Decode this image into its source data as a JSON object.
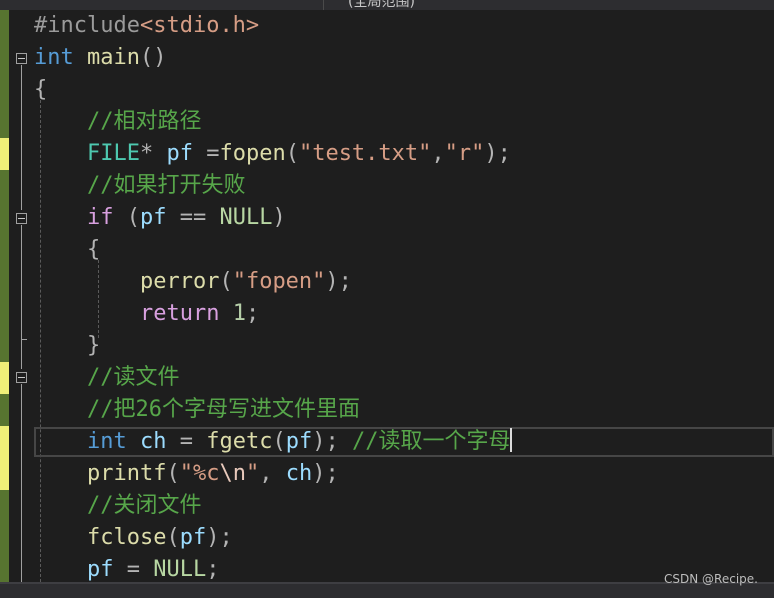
{
  "window": {
    "tab_fragment": "(全局范围)"
  },
  "editor": {
    "lines": {
      "l1_pp": "#include",
      "l1_inc": "<stdio.h>",
      "l2_kw": "int",
      "l2_fn": "main",
      "l2_pu": "()",
      "l3_pu": "{",
      "l4_cm": "//相对路径",
      "l5_ty": "FILE",
      "l5_a": "* ",
      "l5_id": "pf",
      "l5_b": " =",
      "l5_fn": "fopen",
      "l5_c": "(",
      "l5_s1": "\"test.txt\"",
      "l5_d": ",",
      "l5_s2": "\"r\"",
      "l5_e": ");",
      "l6_cm": "//如果打开失败",
      "l7_kw": "if",
      "l7_a": " (",
      "l7_id": "pf",
      "l7_b": " == ",
      "l7_mc": "NULL",
      "l7_c": ")",
      "l8_pu": "{",
      "l9_fn": "perror",
      "l9_a": "(",
      "l9_s": "\"fopen\"",
      "l9_b": ");",
      "l10_kw": "return",
      "l10_sp": " ",
      "l10_num": "1",
      "l10_b": ";",
      "l11_pu": "}",
      "l12_cm": "//读文件",
      "l13_cm": "//把26个字母写进文件里面",
      "l14_kw": "int",
      "l14_sp": " ",
      "l14_id": "ch",
      "l14_a": " = ",
      "l14_fn": "fgetc",
      "l14_b": "(",
      "l14_id2": "pf",
      "l14_c": ");",
      "l14_sp2": " ",
      "l14_cm": "//读取一个字母",
      "l15_fn": "printf",
      "l15_a": "(",
      "l15_s1": "\"%c",
      "l15_esc": "\\n",
      "l15_s2": "\"",
      "l15_b": ", ",
      "l15_id": "ch",
      "l15_c": ");",
      "l16_cm": "//关闭文件",
      "l17_fn": "fclose",
      "l17_a": "(",
      "l17_id": "pf",
      "l17_b": ");",
      "l18_id": "pf",
      "l18_a": " = ",
      "l18_mc": "NULL",
      "l18_b": ";"
    }
  },
  "watermark": "CSDN @Recipe.",
  "colors": {
    "background": "#1e1e1e",
    "keyword": "#569cd6",
    "function": "#dcdcaa",
    "comment": "#57a64a",
    "type": "#4ec9b0",
    "identifier": "#9cdcfe",
    "string": "#d69d85",
    "macro": "#b8d7a3",
    "number": "#b5cea8",
    "control": "#d8a0df",
    "change_saved": "#577430",
    "change_unsaved": "#efef78"
  }
}
